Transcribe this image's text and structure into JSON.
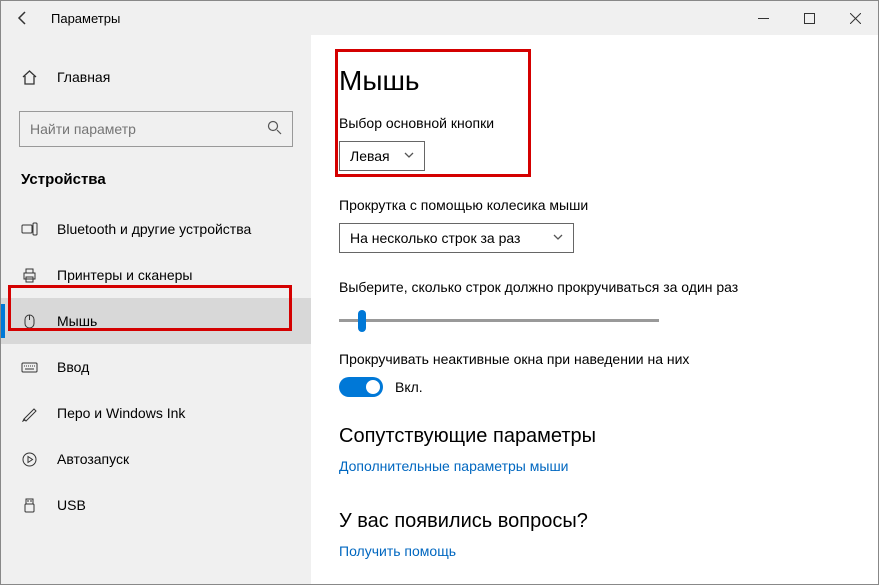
{
  "window": {
    "title": "Параметры"
  },
  "sidebar": {
    "home_label": "Главная",
    "search_placeholder": "Найти параметр",
    "heading": "Устройства",
    "items": [
      {
        "label": "Bluetooth и другие устройства"
      },
      {
        "label": "Принтеры и сканеры"
      },
      {
        "label": "Мышь"
      },
      {
        "label": "Ввод"
      },
      {
        "label": "Перо и Windows Ink"
      },
      {
        "label": "Автозапуск"
      },
      {
        "label": "USB"
      }
    ]
  },
  "main": {
    "title": "Мышь",
    "primary_button_label": "Выбор основной кнопки",
    "primary_button_value": "Левая",
    "scroll_label": "Прокрутка с помощью колесика мыши",
    "scroll_value": "На несколько строк за раз",
    "lines_label": "Выберите, сколько строк должно прокручиваться за один раз",
    "inactive_label": "Прокручивать неактивные окна при наведении на них",
    "toggle_label": "Вкл.",
    "related_heading": "Сопутствующие параметры",
    "related_link": "Дополнительные параметры мыши",
    "help_heading": "У вас появились вопросы?",
    "help_link": "Получить помощь"
  }
}
